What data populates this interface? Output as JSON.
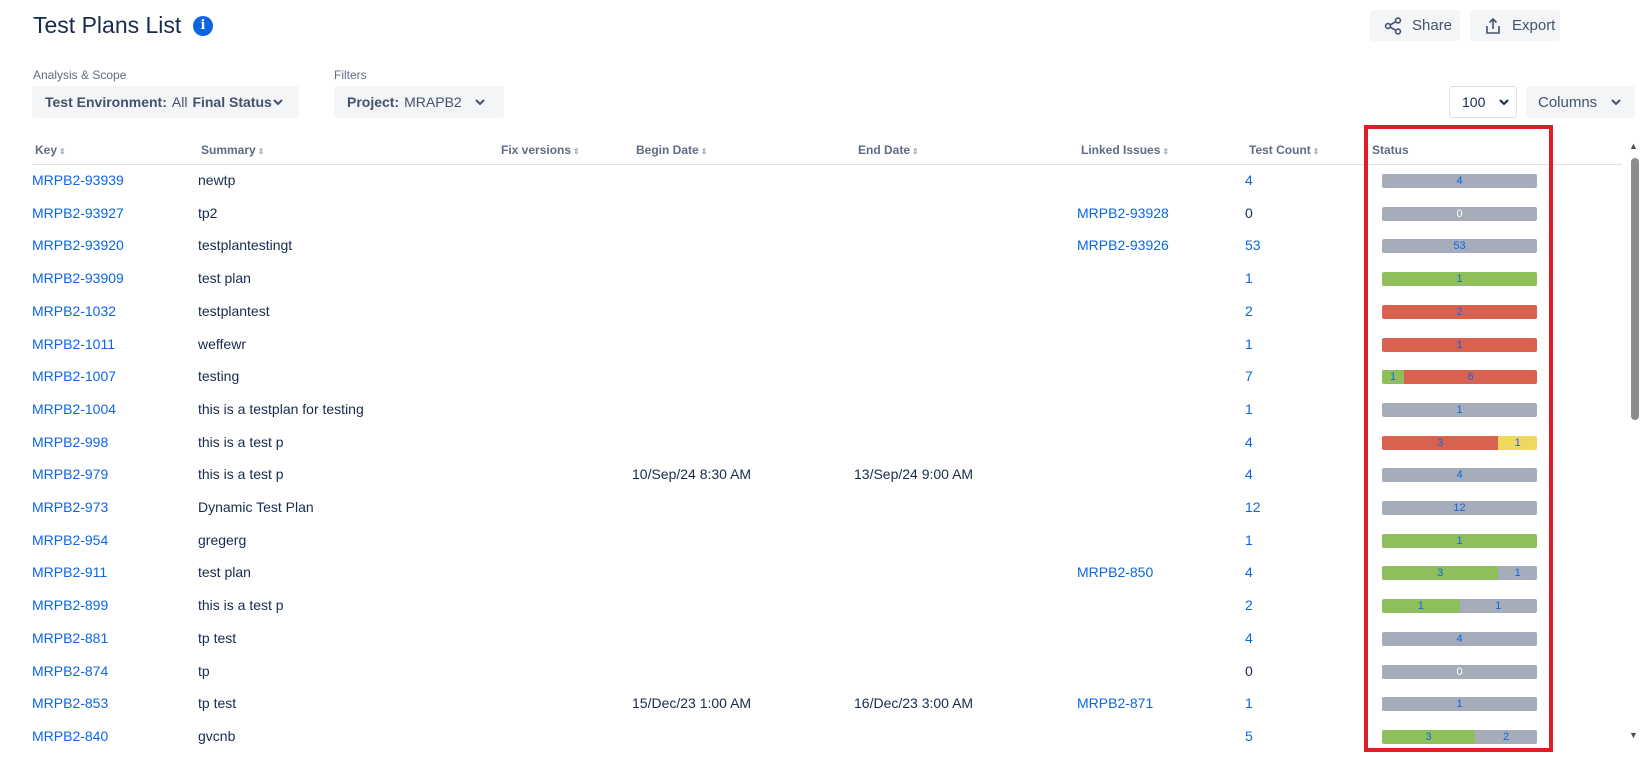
{
  "page": {
    "title": "Test Plans List",
    "share_label": "Share",
    "export_label": "Export"
  },
  "filters": {
    "analysis_label": "Analysis & Scope",
    "analysis_key": "Test Environment:",
    "analysis_value": "All",
    "analysis_extra": "Final Status",
    "filters_label": "Filters",
    "project_key": "Project:",
    "project_value": "MRAPB2",
    "per_page": "100",
    "columns_label": "Columns"
  },
  "table": {
    "headers": {
      "key": "Key",
      "summary": "Summary",
      "fix_versions": "Fix versions",
      "begin_date": "Begin Date",
      "end_date": "End Date",
      "linked_issues": "Linked Issues",
      "test_count": "Test Count",
      "status": "Status"
    },
    "rows": [
      {
        "key": "MRPB2-93939",
        "summary": "newtp",
        "begin": "",
        "end": "",
        "linked": "",
        "count": "4",
        "count_link": true,
        "status": [
          {
            "c": "grey",
            "v": "4",
            "f": 1
          }
        ]
      },
      {
        "key": "MRPB2-93927",
        "summary": "tp2",
        "begin": "",
        "end": "",
        "linked": "MRPB2-93928",
        "count": "0",
        "count_link": false,
        "status": [
          {
            "c": "grey",
            "v": "0",
            "f": 1
          }
        ]
      },
      {
        "key": "MRPB2-93920",
        "summary": "testplantestingt",
        "begin": "",
        "end": "",
        "linked": "MRPB2-93926",
        "count": "53",
        "count_link": true,
        "status": [
          {
            "c": "grey",
            "v": "53",
            "f": 1
          }
        ]
      },
      {
        "key": "MRPB2-93909",
        "summary": "test plan",
        "begin": "",
        "end": "",
        "linked": "",
        "count": "1",
        "count_link": true,
        "status": [
          {
            "c": "green",
            "v": "1",
            "f": 1
          }
        ]
      },
      {
        "key": "MRPB2-1032",
        "summary": "testplantest",
        "begin": "",
        "end": "",
        "linked": "",
        "count": "2",
        "count_link": true,
        "status": [
          {
            "c": "red",
            "v": "2",
            "f": 1
          }
        ]
      },
      {
        "key": "MRPB2-1011",
        "summary": "weffewr",
        "begin": "",
        "end": "",
        "linked": "",
        "count": "1",
        "count_link": true,
        "status": [
          {
            "c": "red",
            "v": "1",
            "f": 1
          }
        ]
      },
      {
        "key": "MRPB2-1007",
        "summary": "testing",
        "begin": "",
        "end": "",
        "linked": "",
        "count": "7",
        "count_link": true,
        "status": [
          {
            "c": "green",
            "v": "1",
            "f": 0.143
          },
          {
            "c": "red",
            "v": "6",
            "f": 0.857
          }
        ]
      },
      {
        "key": "MRPB2-1004",
        "summary": "this is a testplan for testing",
        "begin": "",
        "end": "",
        "linked": "",
        "count": "1",
        "count_link": true,
        "status": [
          {
            "c": "grey",
            "v": "1",
            "f": 1
          }
        ]
      },
      {
        "key": "MRPB2-998",
        "summary": "this is a test p",
        "begin": "",
        "end": "",
        "linked": "",
        "count": "4",
        "count_link": true,
        "status": [
          {
            "c": "red",
            "v": "3",
            "f": 0.75
          },
          {
            "c": "yellow",
            "v": "1",
            "f": 0.25
          }
        ]
      },
      {
        "key": "MRPB2-979",
        "summary": "this is a test p",
        "begin": "10/Sep/24 8:30 AM",
        "end": "13/Sep/24 9:00 AM",
        "linked": "",
        "count": "4",
        "count_link": true,
        "status": [
          {
            "c": "grey",
            "v": "4",
            "f": 1
          }
        ]
      },
      {
        "key": "MRPB2-973",
        "summary": "Dynamic Test Plan",
        "begin": "",
        "end": "",
        "linked": "",
        "count": "12",
        "count_link": true,
        "status": [
          {
            "c": "grey",
            "v": "12",
            "f": 1
          }
        ]
      },
      {
        "key": "MRPB2-954",
        "summary": "gregerg",
        "begin": "",
        "end": "",
        "linked": "",
        "count": "1",
        "count_link": true,
        "status": [
          {
            "c": "green",
            "v": "1",
            "f": 1
          }
        ]
      },
      {
        "key": "MRPB2-911",
        "summary": "test plan",
        "begin": "",
        "end": "",
        "linked": "MRPB2-850",
        "count": "4",
        "count_link": true,
        "status": [
          {
            "c": "green",
            "v": "3",
            "f": 0.75
          },
          {
            "c": "grey",
            "v": "1",
            "f": 0.25
          }
        ]
      },
      {
        "key": "MRPB2-899",
        "summary": "this is a test p",
        "begin": "",
        "end": "",
        "linked": "",
        "count": "2",
        "count_link": true,
        "status": [
          {
            "c": "green",
            "v": "1",
            "f": 0.5
          },
          {
            "c": "grey",
            "v": "1",
            "f": 0.5
          }
        ]
      },
      {
        "key": "MRPB2-881",
        "summary": "tp test",
        "begin": "",
        "end": "",
        "linked": "",
        "count": "4",
        "count_link": true,
        "status": [
          {
            "c": "grey",
            "v": "4",
            "f": 1
          }
        ]
      },
      {
        "key": "MRPB2-874",
        "summary": "tp",
        "begin": "",
        "end": "",
        "linked": "",
        "count": "0",
        "count_link": false,
        "status": [
          {
            "c": "grey",
            "v": "0",
            "f": 1
          }
        ]
      },
      {
        "key": "MRPB2-853",
        "summary": "tp test",
        "begin": "15/Dec/23 1:00 AM",
        "end": "16/Dec/23 3:00 AM",
        "linked": "MRPB2-871",
        "count": "1",
        "count_link": true,
        "status": [
          {
            "c": "grey",
            "v": "1",
            "f": 1
          }
        ]
      },
      {
        "key": "MRPB2-840",
        "summary": "gvcnb",
        "begin": "",
        "end": "",
        "linked": "",
        "count": "5",
        "count_link": true,
        "status": [
          {
            "c": "green",
            "v": "3",
            "f": 0.6
          },
          {
            "c": "grey",
            "v": "2",
            "f": 0.4
          }
        ]
      }
    ]
  },
  "colors": {
    "grey": "#a5adba",
    "green": "#8fbf5a",
    "red": "#d9614f",
    "yellow": "#f0d860",
    "link": "#0c66e4",
    "highlight": "#e01d27"
  }
}
